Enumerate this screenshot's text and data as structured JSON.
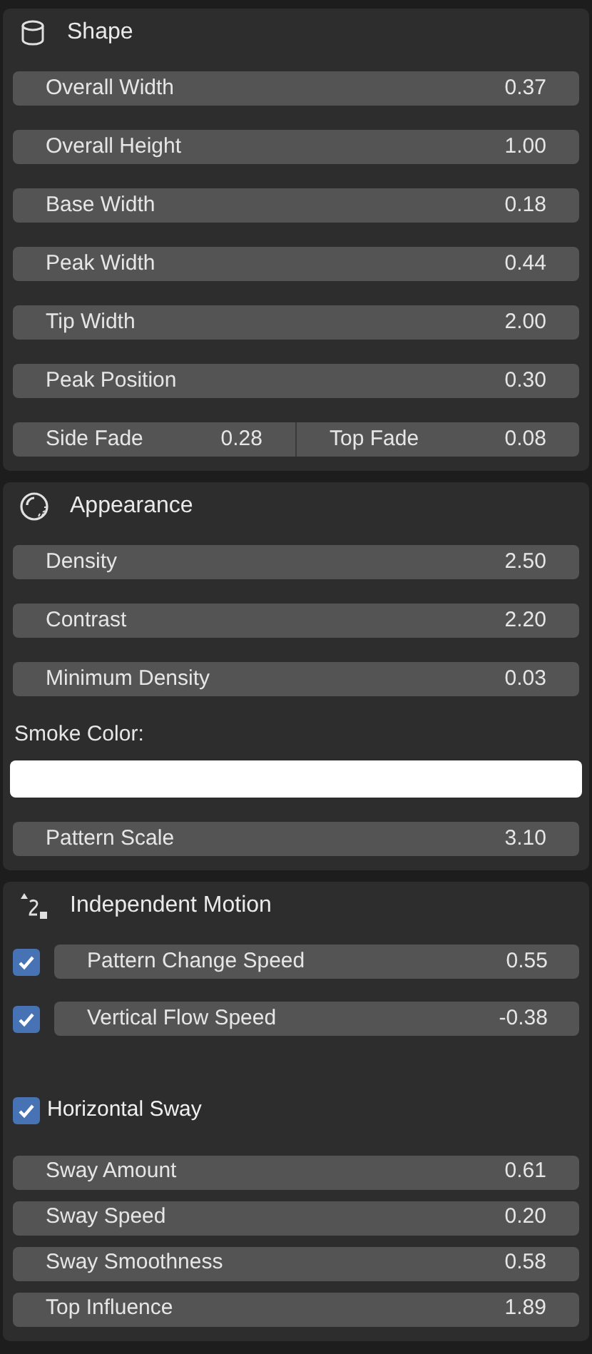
{
  "panels": [
    {
      "title": "Shape",
      "kind": "cylinder",
      "items": [
        {
          "kind": "field",
          "label": "Overall Width",
          "value": "0.37"
        },
        {
          "kind": "field",
          "label": "Overall Height",
          "value": "1.00"
        },
        {
          "kind": "field",
          "label": "Base Width",
          "value": "0.18"
        },
        {
          "kind": "field",
          "label": "Peak Width",
          "value": "0.44"
        },
        {
          "kind": "field",
          "label": "Tip Width",
          "value": "2.00"
        },
        {
          "kind": "field",
          "label": "Peak Position",
          "value": "0.30"
        },
        {
          "kind": "pair",
          "fields": [
            {
              "label": "Side Fade",
              "value": "0.28"
            },
            {
              "label": "Top Fade",
              "value": "0.08"
            }
          ]
        }
      ]
    },
    {
      "title": "Appearance",
      "kind": "sphere",
      "items": [
        {
          "kind": "field",
          "label": "Density",
          "value": "2.50"
        },
        {
          "kind": "field",
          "label": "Contrast",
          "value": "2.20"
        },
        {
          "kind": "field",
          "label": "Minimum Density",
          "value": "0.03"
        },
        {
          "kind": "label",
          "label": "Smoke Color:"
        },
        {
          "kind": "color",
          "color": "#ffffff"
        },
        {
          "kind": "field",
          "label": "Pattern Scale",
          "value": "3.10"
        }
      ]
    },
    {
      "title": "Independent Motion",
      "kind": "motion",
      "items": [
        {
          "kind": "check_field",
          "checked": true,
          "label": "Pattern Change Speed",
          "value": "0.55"
        },
        {
          "kind": "check_field",
          "checked": true,
          "label": "Vertical Flow Speed",
          "value": "-0.38"
        },
        {
          "kind": "checkbox",
          "checked": true,
          "label": "Horizontal Sway"
        },
        {
          "kind": "group",
          "fields": [
            {
              "label": "Sway Amount",
              "value": "0.61"
            },
            {
              "label": "Sway Speed",
              "value": "0.20"
            },
            {
              "label": "Sway Smoothness",
              "value": "0.58"
            },
            {
              "label": "Top Influence",
              "value": "1.89"
            }
          ]
        }
      ]
    }
  ]
}
